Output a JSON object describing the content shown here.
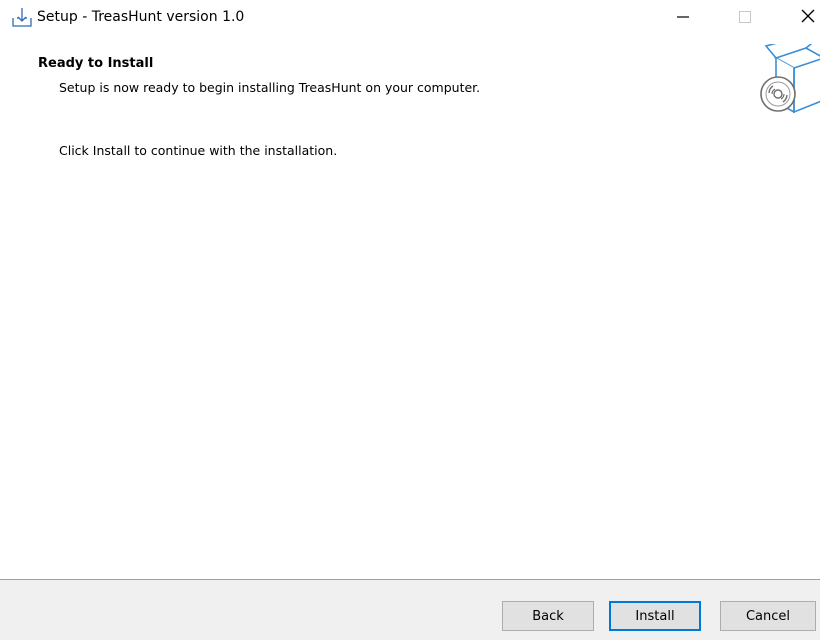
{
  "window": {
    "title": "Setup - TreasHunt version 1.0"
  },
  "header": {
    "title": "Ready to Install",
    "subtitle": "Setup is now ready to begin installing TreasHunt on your computer."
  },
  "body": {
    "instruction": "Click Install to continue with the installation."
  },
  "footer": {
    "back_label": "Back",
    "install_label": "Install",
    "cancel_label": "Cancel"
  },
  "colors": {
    "focus_border": "#0078d7",
    "footer_bg": "#f0f0f0",
    "button_bg": "#e1e1e1"
  },
  "icons": {
    "title": "installer-download-icon",
    "minimize": "minimize-icon",
    "maximize": "maximize-icon",
    "close": "close-icon",
    "header_image": "package-box-disc-icon"
  }
}
